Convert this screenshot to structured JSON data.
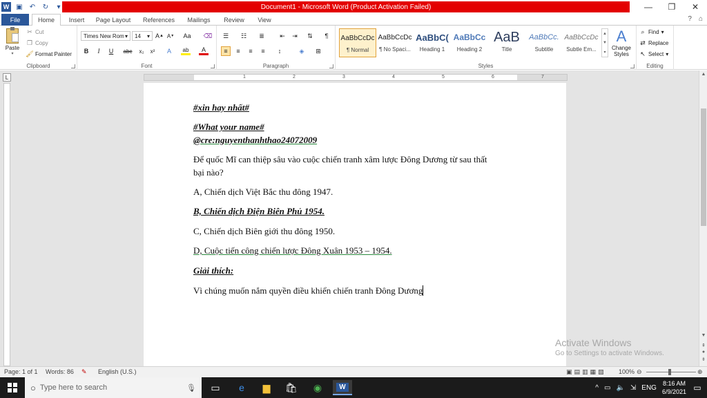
{
  "window": {
    "title": "Document1 - Microsoft Word (Product Activation Failed)",
    "controls": [
      "—",
      "❐",
      "✕"
    ]
  },
  "tabs": [
    "File",
    "Home",
    "Insert",
    "Page Layout",
    "References",
    "Mailings",
    "Review",
    "View"
  ],
  "tabs_right": [
    "?",
    "⌂"
  ],
  "ribbon": {
    "clipboard": {
      "label": "Clipboard",
      "paste": "Paste",
      "cut": "Cut",
      "copy": "Copy",
      "format_painter": "Format Painter"
    },
    "font": {
      "label": "Font",
      "name": "Times New Rom",
      "size": "14"
    },
    "paragraph": {
      "label": "Paragraph"
    },
    "styles": {
      "label": "Styles",
      "items": [
        {
          "preview": "AaBbCcDc",
          "name": "¶ Normal"
        },
        {
          "preview": "AaBbCcDc",
          "name": "¶ No Spaci..."
        },
        {
          "preview": "AaBbC(",
          "name": "Heading 1"
        },
        {
          "preview": "AaBbCc",
          "name": "Heading 2"
        },
        {
          "preview": "AaB",
          "name": "Title"
        },
        {
          "preview": "AaBbCc.",
          "name": "Subtitle"
        },
        {
          "preview": "AaBbCcDc",
          "name": "Subtle Em..."
        }
      ],
      "change_styles": "Change Styles"
    },
    "editing": {
      "label": "Editing",
      "find": "Find",
      "replace": "Replace",
      "select": "Select"
    }
  },
  "ruler_numbers": [
    "1",
    "2",
    "3",
    "4",
    "5",
    "6",
    "7"
  ],
  "document": {
    "p1": "#xin hay nhất#",
    "p2": "#What your name#",
    "p3": "@cre:nguyenthanhthao24072009",
    "p4a": "Để quốc Mĩ can thiệp sâu vào cuộc chiến tranh xâm lược Đông Dương từ sau thất",
    "p4b": "bại nào?",
    "p5": "A, Chiến dịch Việt Bắc thu đông 1947.",
    "p6": "B, Chiến dịch Điện Biên Phủ 1954.",
    "p7": "C, Chiến dịch Biên giới thu đông 1950.",
    "p8": "D, Cuộc tiến công chiến lược Đông Xuân 1953 – 1954.",
    "p9": "Giải thích:",
    "p10": "Vì chúng muốn nắm quyền điều khiển chiến tranh Đông Dương"
  },
  "watermark": {
    "line1": "Activate Windows",
    "line2": "Go to Settings to activate Windows."
  },
  "status": {
    "page": "Page: 1 of 1",
    "words": "Words: 86",
    "language": "English (U.S.)",
    "zoom": "100%"
  },
  "taskbar": {
    "search_placeholder": "Type here to search",
    "lang": "ENG",
    "time": "8:16 AM",
    "date": "6/9/2021"
  }
}
